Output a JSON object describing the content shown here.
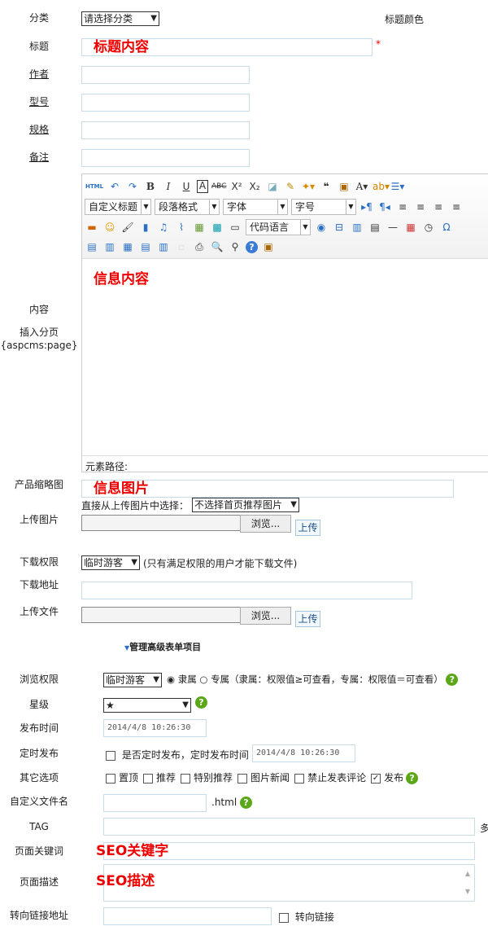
{
  "labels": {
    "category": "分类",
    "title": "标题",
    "author": "作者",
    "model": "型号",
    "spec": "规格",
    "note": "备注",
    "content": "内容",
    "insert_page": "插入分页",
    "page_tag": "{aspcms:page}",
    "thumb": "产品缩略图",
    "upload_image": "上传图片",
    "download_perm": "下载权限",
    "download_url": "下载地址",
    "upload_file": "上传文件",
    "view_perm": "浏览权限",
    "star": "星级",
    "pub_time": "发布时间",
    "timed_pub": "定时发布",
    "other": "其它选项",
    "custom_filename": "自定义文件名",
    "tag": "TAG",
    "keywords": "页面关键词",
    "description": "页面描述",
    "redirect": "转向链接地址"
  },
  "category_select": "请选择分类",
  "title_color_label": "标题颜色",
  "title_value": "标题内容",
  "required_mark": "*",
  "editor": {
    "html_btn": "HTML",
    "custom_title": "自定义标题",
    "paragraph": "段落格式",
    "font": "字体",
    "font_size": "字号",
    "code_lang": "代码语言",
    "content": "信息内容",
    "path_label": "元素路径:"
  },
  "thumb_value": "信息图片",
  "choose_from_uploaded": "直接从上传图片中选择：",
  "homepage_image_select": "不选择首页推荐图片",
  "browse": "浏览...",
  "upload": "上传",
  "download_perm_select": "临时游客",
  "download_perm_note": "(只有满足权限的用户才能下载文件)",
  "advanced_toggle": "管理高级表单项目",
  "view_perm_select": "临时游客",
  "radio_belong": "隶属",
  "radio_exclusive": "专属",
  "perm_note": "（隶属：权限值≥可查看，专属：权限值＝可查看）",
  "star_select": "★",
  "pub_time_value": "2014/4/8 10:26:30",
  "timed_pub_text": "是否定时发布，定时发布时间",
  "timed_pub_value": "2014/4/8 10:26:30",
  "options": [
    {
      "label": "置顶",
      "checked": false
    },
    {
      "label": "推荐",
      "checked": false
    },
    {
      "label": "特别推荐",
      "checked": false
    },
    {
      "label": "图片新闻",
      "checked": false
    },
    {
      "label": "禁止发表评论",
      "checked": false
    },
    {
      "label": "发布",
      "checked": true
    }
  ],
  "html_ext": ".html",
  "tag_suffix": "多",
  "keywords_value": "SEO关键字",
  "description_value": "SEO描述",
  "redirect_checkbox": "转向链接"
}
